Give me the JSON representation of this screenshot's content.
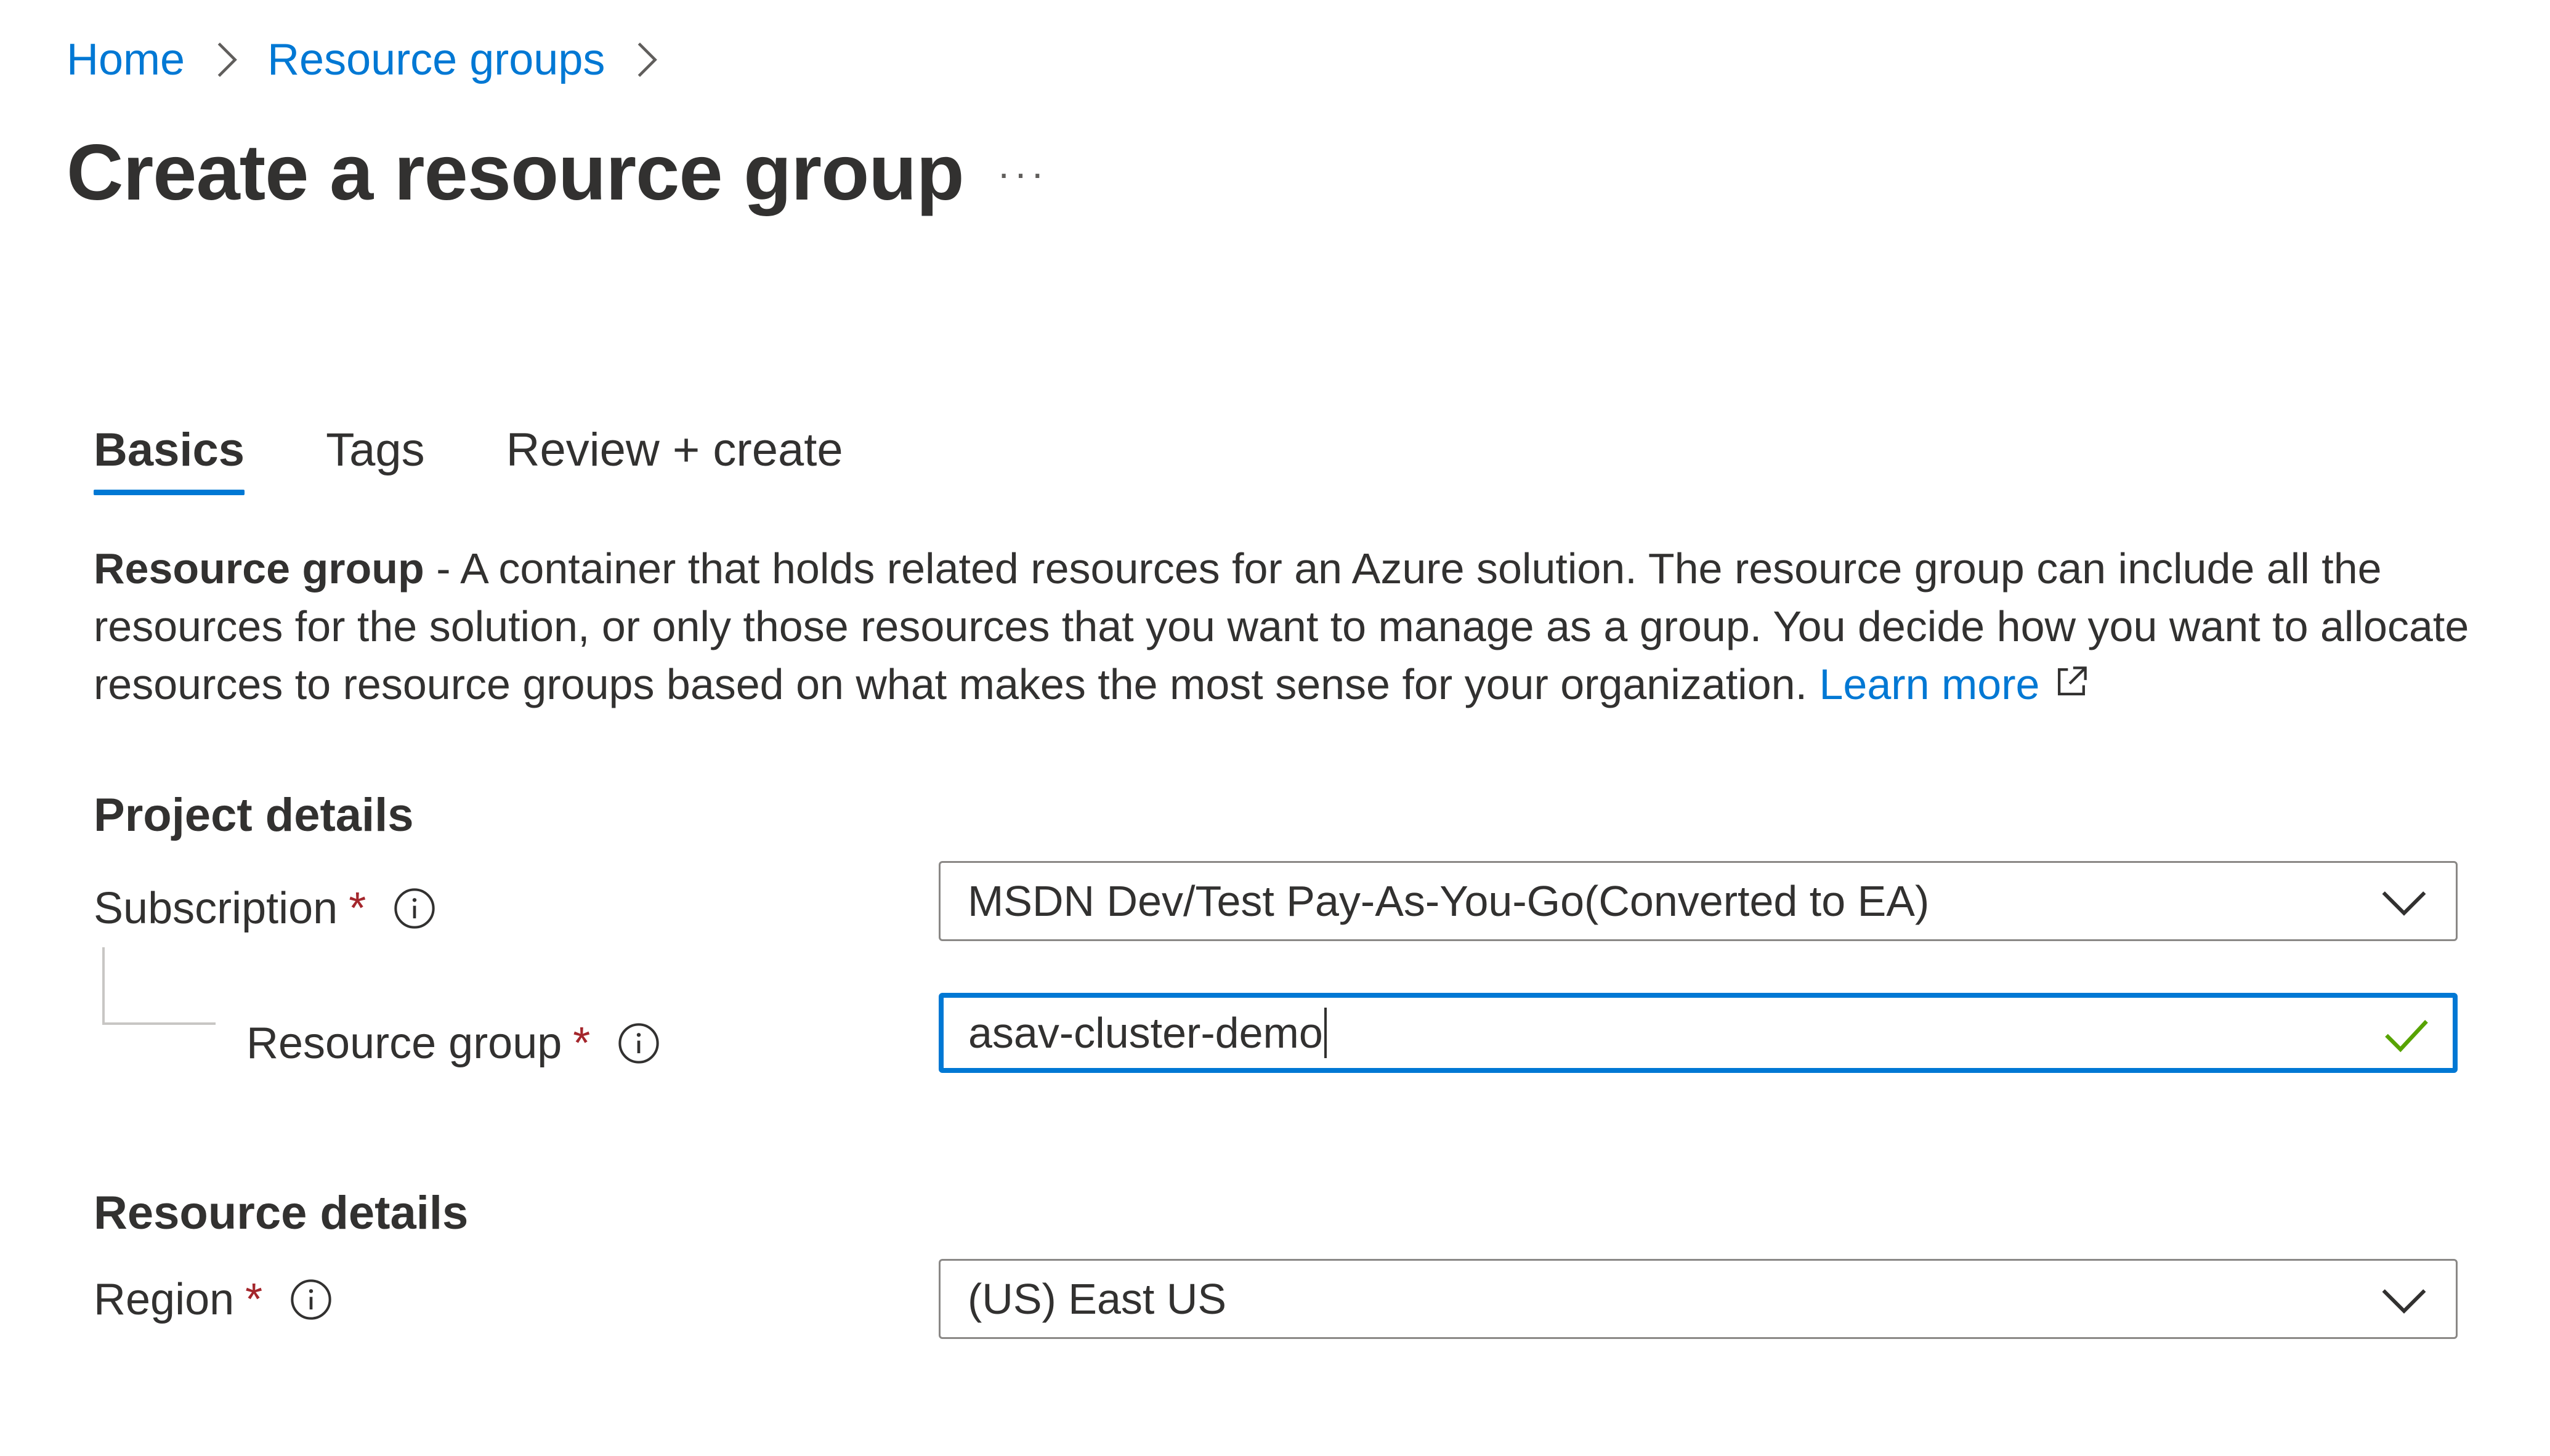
{
  "breadcrumb": {
    "items": [
      "Home",
      "Resource groups"
    ]
  },
  "page": {
    "title": "Create a resource group",
    "more_label": "···"
  },
  "tabs": [
    {
      "label": "Basics",
      "active": true
    },
    {
      "label": "Tags",
      "active": false
    },
    {
      "label": "Review + create",
      "active": false
    }
  ],
  "description": {
    "bold": "Resource group",
    "text": " - A container that holds related resources for an Azure solution. The resource group can include all the resources for the solution, or only those resources that you want to manage as a group. You decide how you want to allocate resources to resource groups based on what makes the most sense for your organization. ",
    "link": "Learn more"
  },
  "project_details": {
    "title": "Project details",
    "subscription": {
      "label": "Subscription",
      "required": "*",
      "value": "MSDN Dev/Test Pay-As-You-Go(Converted to EA)"
    },
    "resource_group": {
      "label": "Resource group",
      "required": "*",
      "value": "asav-cluster-demo"
    }
  },
  "resource_details": {
    "title": "Resource details",
    "region": {
      "label": "Region",
      "required": "*",
      "value": "(US) East US"
    }
  },
  "colors": {
    "accent": "#0078d4",
    "required": "#a4262c",
    "valid": "#57a300",
    "text": "#323130"
  },
  "icons": [
    "chevron-right-icon",
    "more-icon",
    "external-link-icon",
    "info-icon",
    "chevron-down-icon",
    "checkmark-icon"
  ]
}
